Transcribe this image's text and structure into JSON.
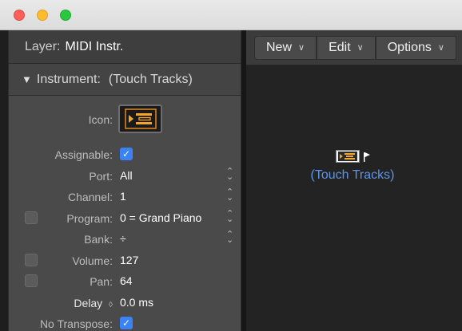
{
  "window": {
    "controls": [
      "close",
      "minimize",
      "zoom"
    ]
  },
  "inspector": {
    "layer_label": "Layer:",
    "layer_value": "MIDI Instr.",
    "section_triangle": "▼",
    "section_label": "Instrument:",
    "section_name": "(Touch Tracks)",
    "icon_label": "Icon:",
    "assignable_label": "Assignable:",
    "port_label": "Port:",
    "port_value": "All",
    "channel_label": "Channel:",
    "channel_value": "1",
    "program_label": "Program:",
    "program_value": "0 = Grand Piano",
    "bank_label": "Bank:",
    "bank_value": "÷",
    "volume_label": "Volume:",
    "volume_value": "127",
    "pan_label": "Pan:",
    "pan_value": "64",
    "delay_label": "Delay",
    "delay_value": "0.0 ms",
    "no_transpose_label": "No Transpose:",
    "check_glyph": "✓",
    "stepper_up": "⌃",
    "stepper_down": "⌄",
    "accent_color": "#3a82f6"
  },
  "editor": {
    "menus": [
      {
        "label": "New",
        "chevron": "∨"
      },
      {
        "label": "Edit",
        "chevron": "∨"
      },
      {
        "label": "Options",
        "chevron": "∨"
      }
    ],
    "object_label": "(Touch Tracks)",
    "object_label_color": "#5d95e8"
  }
}
